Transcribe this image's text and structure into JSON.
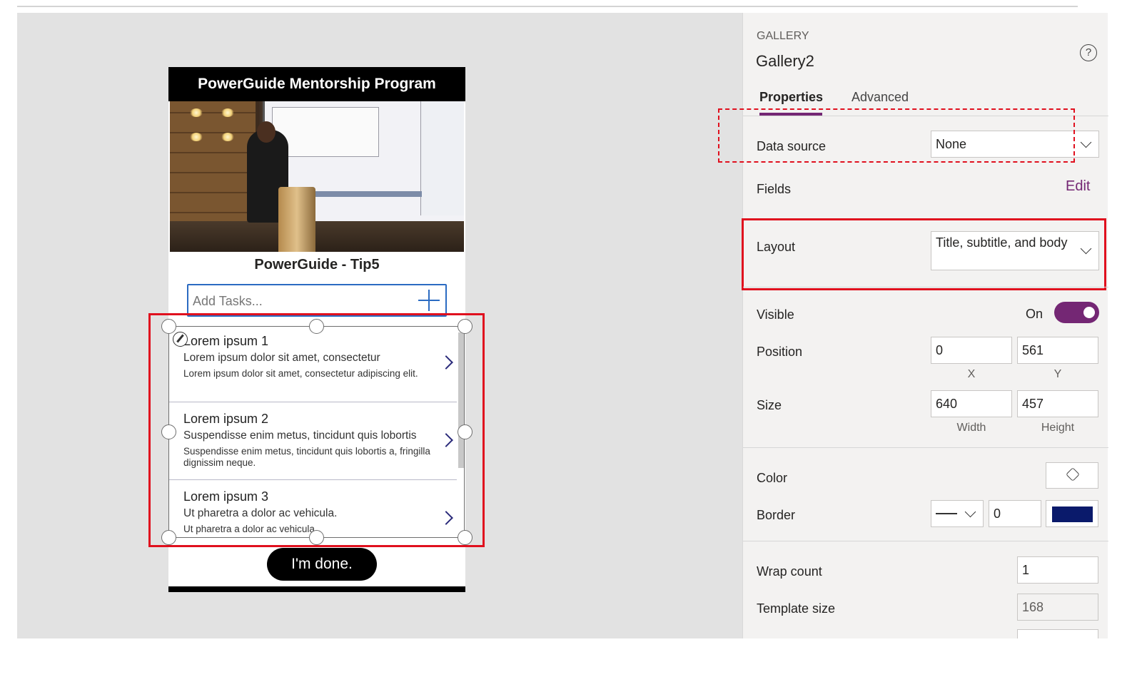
{
  "app": {
    "header_title": "PowerGuide Mentorship Program",
    "subtitle": "PowerGuide - Tip5",
    "add_task_placeholder": "Add Tasks...",
    "done_button": "I'm done.",
    "gallery_items": [
      {
        "title": "Lorem ipsum 1",
        "subtitle": "Lorem ipsum dolor sit amet, consectetur",
        "body": "Lorem ipsum dolor sit amet, consectetur adipiscing elit."
      },
      {
        "title": "Lorem ipsum 2",
        "subtitle": "Suspendisse enim metus, tincidunt quis lobortis",
        "body": "Suspendisse enim metus, tincidunt quis lobortis a, fringilla dignissim neque."
      },
      {
        "title": "Lorem ipsum 3",
        "subtitle": "Ut pharetra a dolor ac vehicula.",
        "body": "Ut pharetra a dolor ac vehicula."
      }
    ]
  },
  "panel": {
    "control_type": "GALLERY",
    "control_name": "Gallery2",
    "help_label": "?",
    "tabs": {
      "properties": "Properties",
      "advanced": "Advanced"
    },
    "data_source": {
      "label": "Data source",
      "value": "None"
    },
    "fields": {
      "label": "Fields",
      "edit_link": "Edit"
    },
    "layout": {
      "label": "Layout",
      "value": "Title, subtitle, and body"
    },
    "visible": {
      "label": "Visible",
      "state": "On"
    },
    "position": {
      "label": "Position",
      "x": "0",
      "y": "561",
      "x_caption": "X",
      "y_caption": "Y"
    },
    "size": {
      "label": "Size",
      "width": "640",
      "height": "457",
      "width_caption": "Width",
      "height_caption": "Height"
    },
    "color": {
      "label": "Color"
    },
    "border": {
      "label": "Border",
      "thickness": "0",
      "color": "#0a1a6b"
    },
    "wrap_count": {
      "label": "Wrap count",
      "value": "1"
    },
    "template_size": {
      "label": "Template size",
      "value": "168"
    }
  },
  "colors": {
    "accent": "#742774",
    "selection_red": "#e0101e",
    "input_border": "#2b6bc2"
  }
}
